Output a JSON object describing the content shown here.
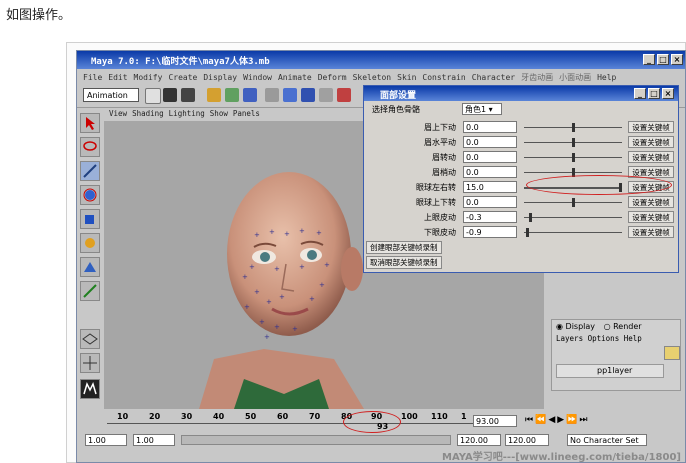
{
  "caption": "如图操作。",
  "window": {
    "title": "Maya 7.0: F:\\临时文件\\maya7人体3.mb",
    "menus": [
      "File",
      "Edit",
      "Modify",
      "Create",
      "Display",
      "Window",
      "Animate",
      "Deform",
      "Skeleton",
      "Skin",
      "Constrain",
      "Character",
      "牙齿动画",
      "小面动画",
      "Help"
    ],
    "menuset": "Animation",
    "min_glyph": "_",
    "max_glyph": "□",
    "close_glyph": "×"
  },
  "viewport_menu": [
    "View",
    "Shading",
    "Lighting",
    "Show",
    "Panels"
  ],
  "dialog": {
    "title": "面部设置",
    "select_label": "选择角色骨骼",
    "select_value": "角色1",
    "rows": [
      {
        "label": "眉上下动",
        "value": "0.0",
        "slider": 0.5
      },
      {
        "label": "眉水平动",
        "value": "0.0",
        "slider": 0.5
      },
      {
        "label": "眉转动",
        "value": "0.0",
        "slider": 0.5
      },
      {
        "label": "眉梢动",
        "value": "0.0",
        "slider": 0.5
      },
      {
        "label": "眼球左右转",
        "value": "15.0",
        "slider": 1.0
      },
      {
        "label": "眼球上下转",
        "value": "0.0",
        "slider": 0.5
      },
      {
        "label": "上眼皮动",
        "value": "-0.3",
        "slider": 0.05
      },
      {
        "label": "下眼皮动",
        "value": "-0.9",
        "slider": 0.02
      }
    ],
    "key_button": "设置关键帧",
    "create_btn": "创建眼部关键帧录制",
    "cancel_btn": "取消眼部关键帧录制"
  },
  "panel": {
    "display": "Display",
    "render": "Render",
    "layer_menus": [
      "Layers",
      "Options",
      "Help"
    ],
    "layer_name": "pp1layer"
  },
  "timeline": {
    "ticks": [
      "10",
      "20",
      "30",
      "40",
      "50",
      "60",
      "70",
      "80",
      "90",
      "100",
      "110",
      "1"
    ],
    "current": "93",
    "current_field": "93.00"
  },
  "range": {
    "start": "1.00",
    "start2": "1.00",
    "end": "120.00",
    "end2": "120.00",
    "character_set": "No Character Set"
  },
  "watermark": "MAYA学习吧---[www.lineeg.com/tieba/1800]"
}
